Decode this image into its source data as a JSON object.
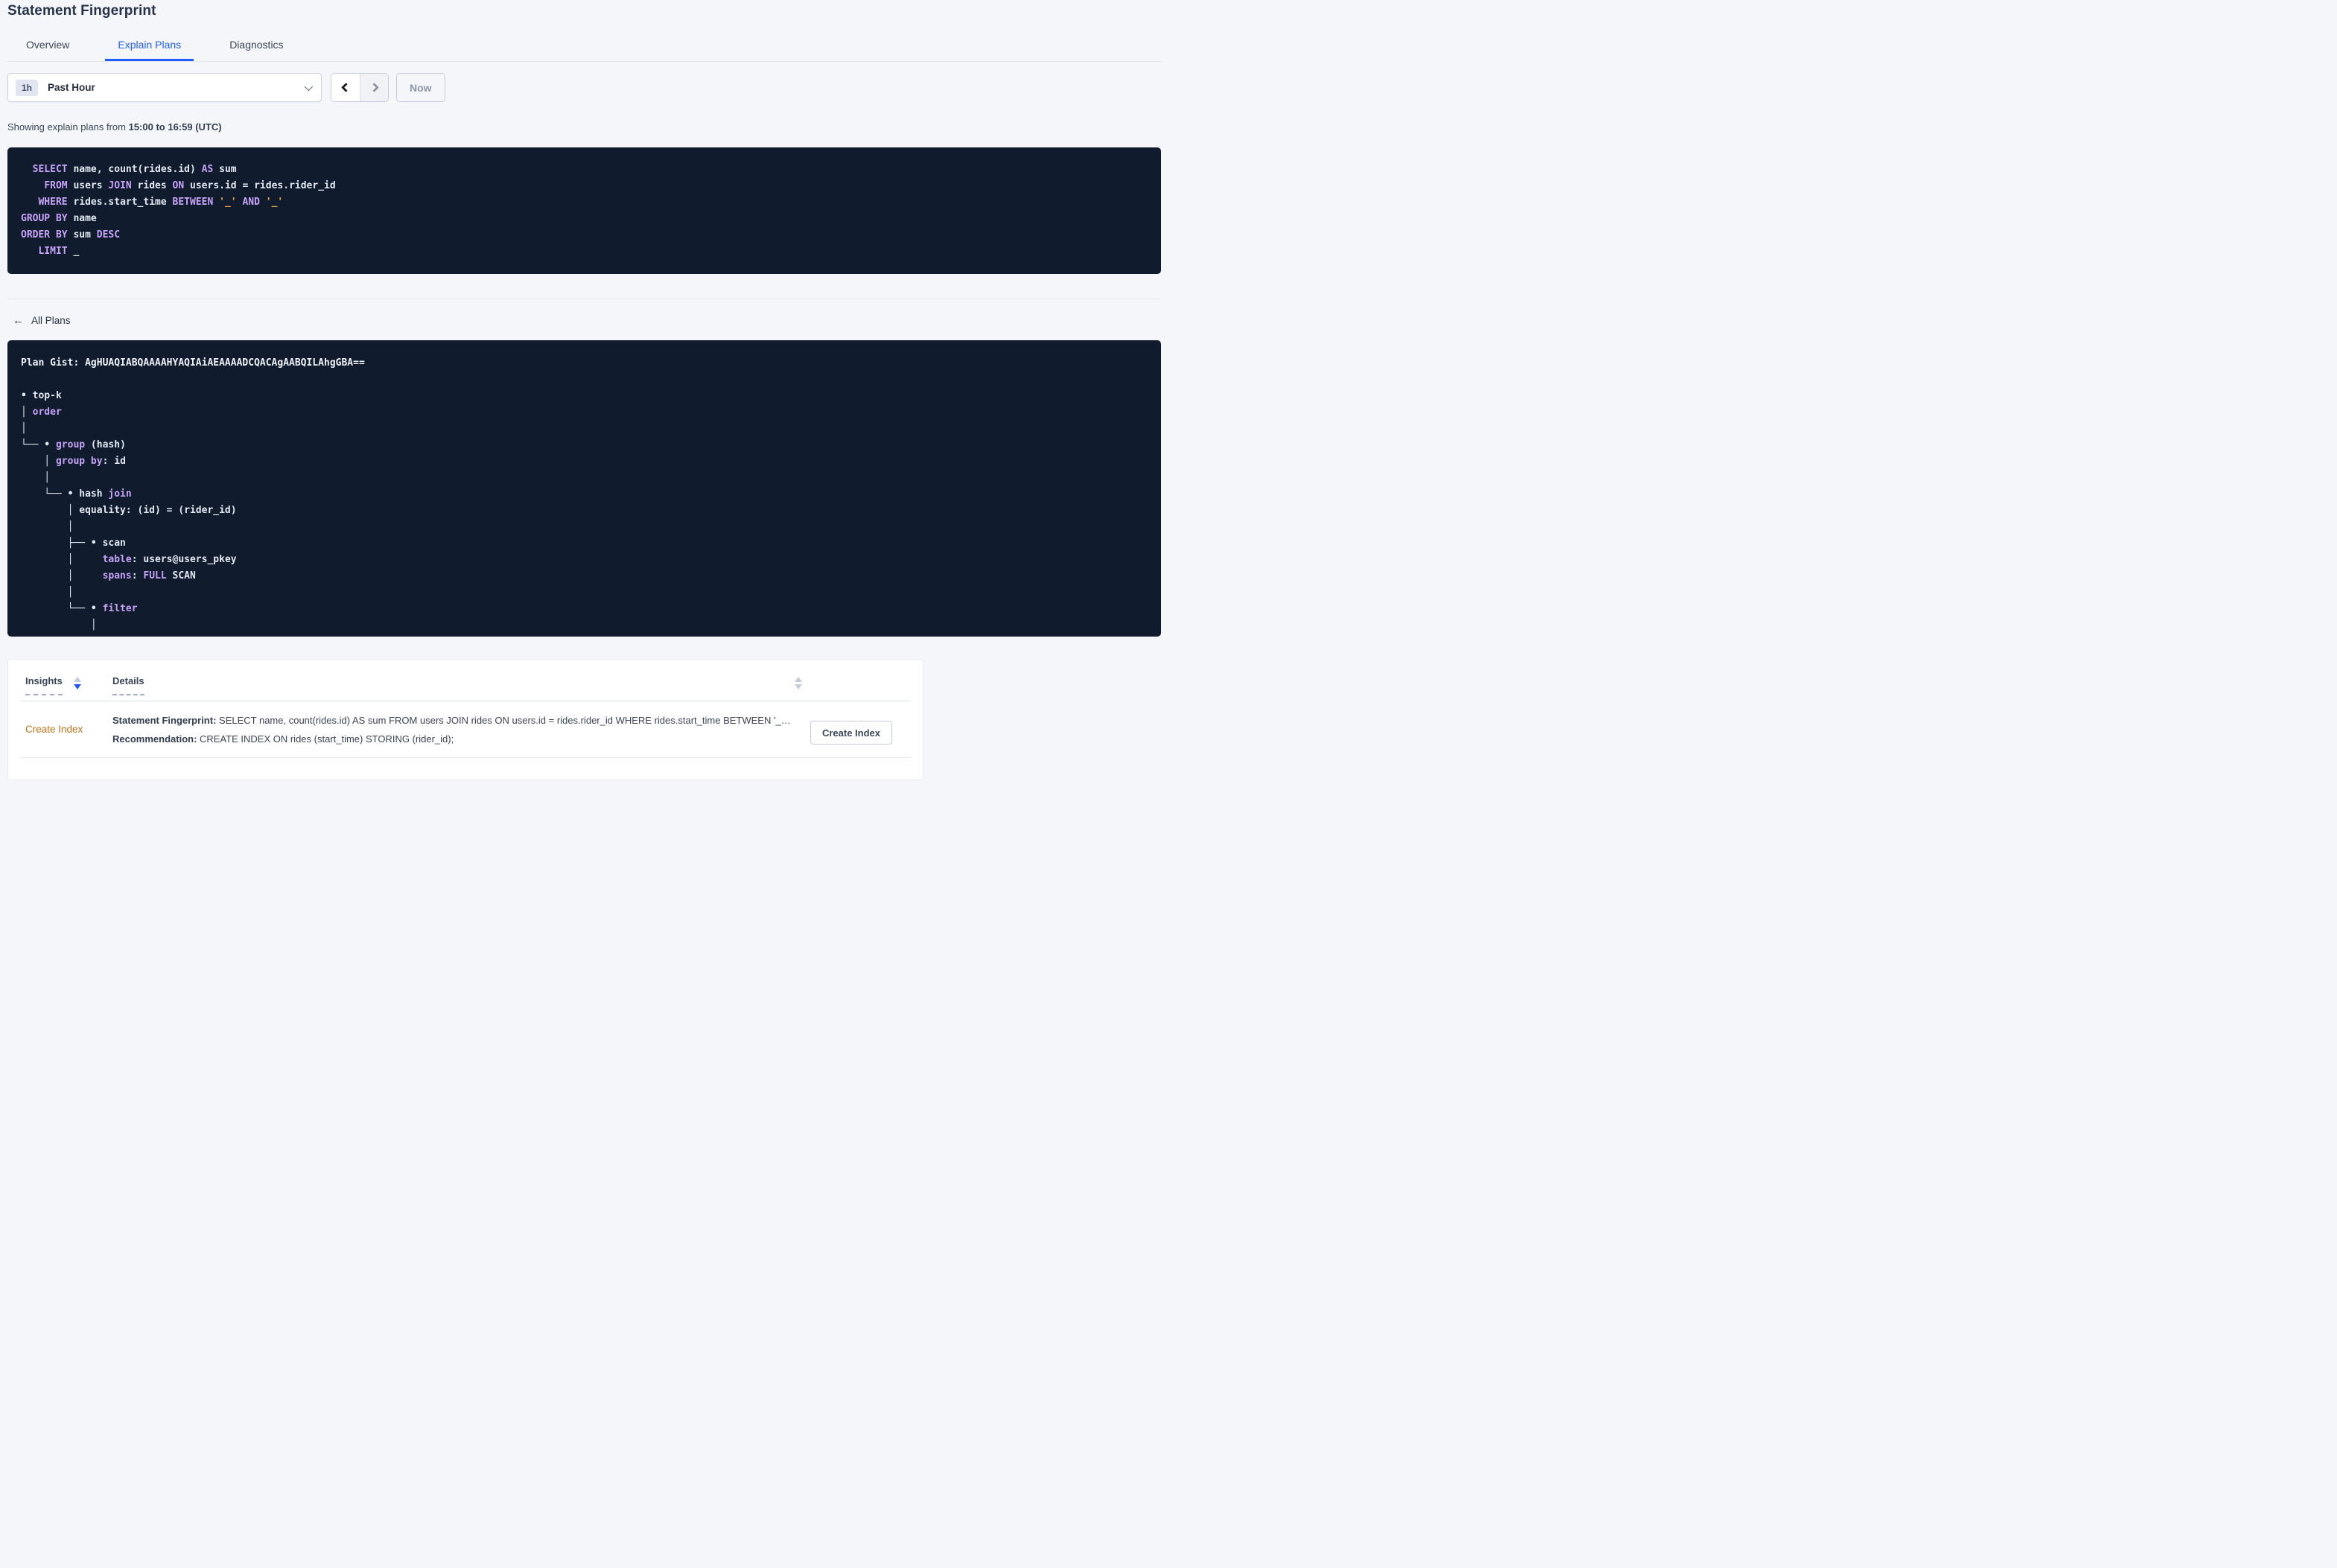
{
  "colors": {
    "accent_blue": "#1f5eff",
    "code_background": "#101b2e",
    "code_keyword": "#c7a4f7",
    "code_text": "#e3e9f3",
    "code_literal": "#f0a13d",
    "insight_orange": "#bb7419",
    "page_background": "#f5f6fa"
  },
  "icons": {
    "back_arrow": "←"
  },
  "header": {
    "title": "Statement Fingerprint"
  },
  "tabs": [
    {
      "label": "Overview"
    },
    {
      "label": "Explain Plans"
    },
    {
      "label": "Diagnostics"
    }
  ],
  "active_tab": "Explain Plans",
  "time_controls": {
    "interval_badge": "1h",
    "selected_range": "Past Hour",
    "now_label": "Now"
  },
  "showing_line": {
    "prefix": "Showing explain plans from ",
    "bold_range": "15:00 to 16:59 (UTC)"
  },
  "sql_box": {
    "lines": [
      [
        {
          "t": "  ",
          "c": "w"
        },
        {
          "t": "SELECT",
          "c": "k"
        },
        {
          "t": " name, count(rides.id) ",
          "c": "w"
        },
        {
          "t": "AS",
          "c": "k"
        },
        {
          "t": " sum",
          "c": "w"
        }
      ],
      [
        {
          "t": "    ",
          "c": "w"
        },
        {
          "t": "FROM",
          "c": "k"
        },
        {
          "t": " users ",
          "c": "w"
        },
        {
          "t": "JOIN",
          "c": "k"
        },
        {
          "t": " rides ",
          "c": "w"
        },
        {
          "t": "ON",
          "c": "k"
        },
        {
          "t": " users.id = rides.rider_id",
          "c": "w"
        }
      ],
      [
        {
          "t": "   ",
          "c": "w"
        },
        {
          "t": "WHERE",
          "c": "k"
        },
        {
          "t": " rides.start_time ",
          "c": "w"
        },
        {
          "t": "BETWEEN",
          "c": "k"
        },
        {
          "t": " ",
          "c": "w"
        },
        {
          "t": "'_'",
          "c": "o"
        },
        {
          "t": " ",
          "c": "w"
        },
        {
          "t": "AND",
          "c": "k"
        },
        {
          "t": " ",
          "c": "w"
        },
        {
          "t": "'_'",
          "c": "o"
        }
      ],
      [
        {
          "t": "GROUP BY",
          "c": "k"
        },
        {
          "t": " name",
          "c": "w"
        }
      ],
      [
        {
          "t": "ORDER BY",
          "c": "k"
        },
        {
          "t": " sum ",
          "c": "w"
        },
        {
          "t": "DESC",
          "c": "k"
        }
      ],
      [
        {
          "t": "   ",
          "c": "w"
        },
        {
          "t": "LIMIT",
          "c": "k"
        },
        {
          "t": " _",
          "c": "w"
        }
      ]
    ]
  },
  "plans_section": {
    "back_label": "All Plans",
    "plan_gist_line": "Plan Gist: AgHUAQIABQAAAAHYAQIAiAEAAAADCQACAgAABQILAhgGBA==",
    "tree_lines": [
      [],
      [
        {
          "t": "• top-k",
          "c": "w"
        }
      ],
      [
        {
          "t": "│ ",
          "c": "w"
        },
        {
          "t": "order",
          "c": "k"
        }
      ],
      [
        {
          "t": "│",
          "c": "w"
        }
      ],
      [
        {
          "t": "└── • ",
          "c": "w"
        },
        {
          "t": "group",
          "c": "k"
        },
        {
          "t": " (hash)",
          "c": "w"
        }
      ],
      [
        {
          "t": "    │ ",
          "c": "w"
        },
        {
          "t": "group by",
          "c": "k"
        },
        {
          "t": ": id",
          "c": "w"
        }
      ],
      [
        {
          "t": "    │",
          "c": "w"
        }
      ],
      [
        {
          "t": "    └── • hash ",
          "c": "w"
        },
        {
          "t": "join",
          "c": "k"
        }
      ],
      [
        {
          "t": "        │ equality: (id) = (rider_id)",
          "c": "w"
        }
      ],
      [
        {
          "t": "        │",
          "c": "w"
        }
      ],
      [
        {
          "t": "        ├── • scan",
          "c": "w"
        }
      ],
      [
        {
          "t": "        │     ",
          "c": "w"
        },
        {
          "t": "table",
          "c": "k"
        },
        {
          "t": ": users@users_pkey",
          "c": "w"
        }
      ],
      [
        {
          "t": "        │     ",
          "c": "w"
        },
        {
          "t": "spans",
          "c": "k"
        },
        {
          "t": ": ",
          "c": "w"
        },
        {
          "t": "FULL",
          "c": "k"
        },
        {
          "t": " SCAN",
          "c": "w"
        }
      ],
      [
        {
          "t": "        │",
          "c": "w"
        }
      ],
      [
        {
          "t": "        └── • ",
          "c": "w"
        },
        {
          "t": "filter",
          "c": "k"
        }
      ],
      [
        {
          "t": "            │",
          "c": "w"
        }
      ]
    ]
  },
  "insights_table": {
    "col_insights": "Insights",
    "col_details": "Details",
    "row": {
      "insight": "Create Index",
      "statement_label": "Statement Fingerprint:",
      "statement_text": " SELECT name, count(rides.id) AS sum FROM users JOIN rides ON users.id = rides.rider_id WHERE rides.start_time BETWEEN '_…",
      "recommendation_label": "Recommendation:",
      "recommendation_text": " CREATE INDEX ON rides (start_time) STORING (rider_id);",
      "action_label": "Create Index"
    }
  }
}
